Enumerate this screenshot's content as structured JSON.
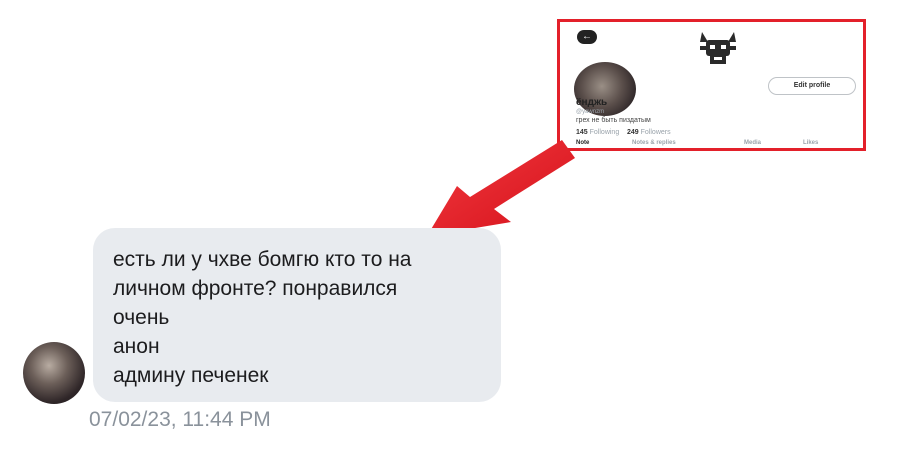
{
  "inset_profile": {
    "back_icon": "arrow-left-icon",
    "banner_icon": "cat-emblem-icon",
    "edit_label": "Edit profile",
    "name": "ёнджь",
    "handle": "@yawnzm",
    "bio": "грех не быть пиздатым",
    "following_count": "145",
    "following_label": "Following",
    "followers_count": "249",
    "followers_label": "Followers",
    "tabs": [
      "Note",
      "Notes & replies",
      "Media",
      "Likes"
    ],
    "border_color": "#e3202a"
  },
  "message": {
    "lines": [
      "есть ли у чхве бомгю кто то на",
      "личном фронте? понравился",
      "очень",
      "анон",
      "админу печенек"
    ],
    "timestamp": "07/02/23, 11:44 PM",
    "bubble_color": "#e8ebef"
  },
  "arrow_color": "#e8191f"
}
